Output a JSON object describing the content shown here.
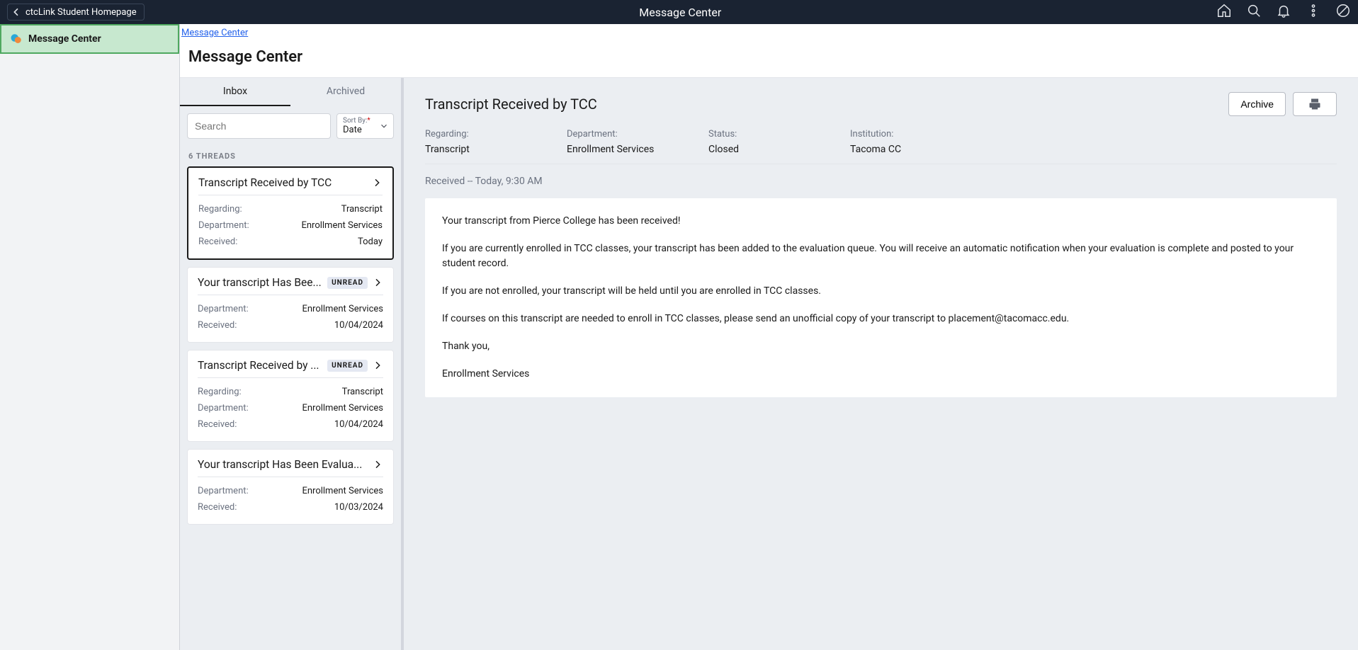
{
  "topbar": {
    "back_label": "ctcLink Student Homepage",
    "title": "Message Center"
  },
  "sidebar": {
    "active_label": "Message Center"
  },
  "crumb": {
    "label": "Message Center"
  },
  "page_title": "Message Center",
  "tabs": {
    "inbox": "Inbox",
    "archived": "Archived"
  },
  "search": {
    "placeholder": "Search"
  },
  "sort": {
    "label": "Sort By:",
    "value": "Date"
  },
  "thread_count": "6 THREADS",
  "threads": [
    {
      "title": "Transcript Received by TCC",
      "unread": false,
      "selected": true,
      "rows": [
        {
          "k": "Regarding:",
          "v": "Transcript"
        },
        {
          "k": "Department:",
          "v": "Enrollment Services"
        },
        {
          "k": "Received:",
          "v": "Today"
        }
      ]
    },
    {
      "title": "Your transcript Has Bee...",
      "unread": true,
      "selected": false,
      "rows": [
        {
          "k": "Department:",
          "v": "Enrollment Services"
        },
        {
          "k": "Received:",
          "v": "10/04/2024"
        }
      ]
    },
    {
      "title": "Transcript Received by ...",
      "unread": true,
      "selected": false,
      "rows": [
        {
          "k": "Regarding:",
          "v": "Transcript"
        },
        {
          "k": "Department:",
          "v": "Enrollment Services"
        },
        {
          "k": "Received:",
          "v": "10/04/2024"
        }
      ]
    },
    {
      "title": "Your transcript Has Been Evalua...",
      "unread": false,
      "selected": false,
      "rows": [
        {
          "k": "Department:",
          "v": "Enrollment Services"
        },
        {
          "k": "Received:",
          "v": "10/03/2024"
        }
      ]
    }
  ],
  "unread_label": "UNREAD",
  "detail": {
    "title": "Transcript Received by TCC",
    "archive_btn": "Archive",
    "meta": [
      {
        "k": "Regarding:",
        "v": "Transcript"
      },
      {
        "k": "Department:",
        "v": "Enrollment Services"
      },
      {
        "k": "Status:",
        "v": "Closed"
      },
      {
        "k": "Institution:",
        "v": "Tacoma CC"
      }
    ],
    "received_line": "Received -- Today, 9:30 AM",
    "body": [
      "Your transcript from Pierce College has been received!",
      "If you are currently enrolled in TCC classes, your transcript has been added to the evaluation queue. You will receive an automatic notification when your evaluation is complete and posted to your student record.",
      "If you are not enrolled, your transcript will be held until you are enrolled in TCC classes.",
      "If courses on this transcript are needed to enroll in TCC classes, please send an unofficial copy of your transcript to placement@tacomacc.edu.",
      "Thank you,",
      "Enrollment Services"
    ]
  }
}
